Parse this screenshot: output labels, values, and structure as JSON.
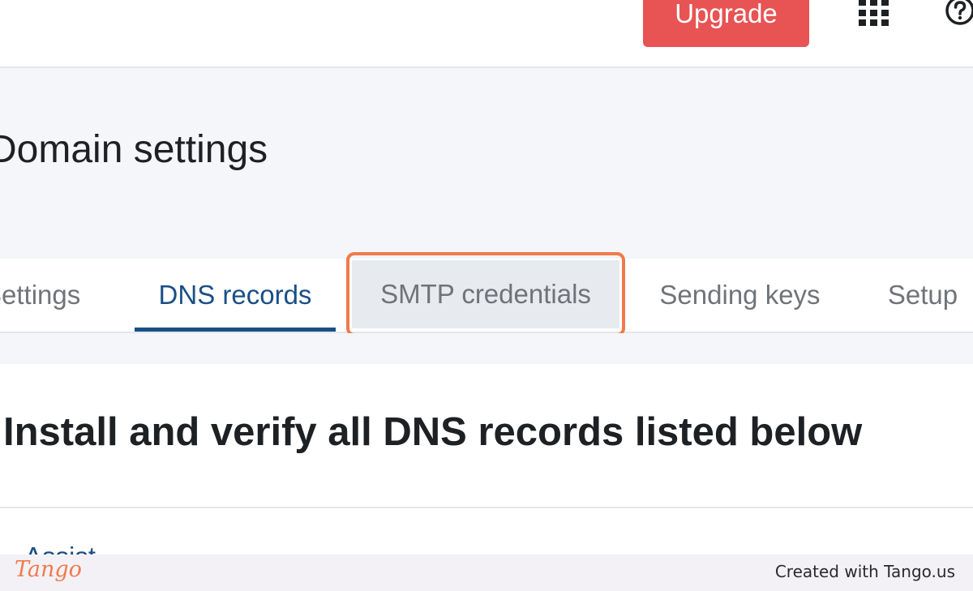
{
  "topbar": {
    "upgrade_label": "Upgrade",
    "apps_icon": "grid-apps-icon",
    "help_icon": "help-circle-icon"
  },
  "header": {
    "title": "Domain settings"
  },
  "tabs": [
    {
      "label": "Settings",
      "selected": false
    },
    {
      "label": "DNS records",
      "selected": true
    },
    {
      "label": "SMTP credentials",
      "selected": false,
      "highlighted": true
    },
    {
      "label": "Sending keys",
      "selected": false
    },
    {
      "label": "Setup",
      "selected": false
    }
  ],
  "section": {
    "heading": "Install and verify all DNS records listed below",
    "peek_text": "Assist"
  },
  "footer": {
    "logo_text": "Tango",
    "credit": "Created with Tango.us"
  },
  "colors": {
    "upgrade": "#e85354",
    "tab_active": "#1a4f86",
    "highlight": "#f07a4c",
    "header_bg": "#f4f6f9"
  }
}
